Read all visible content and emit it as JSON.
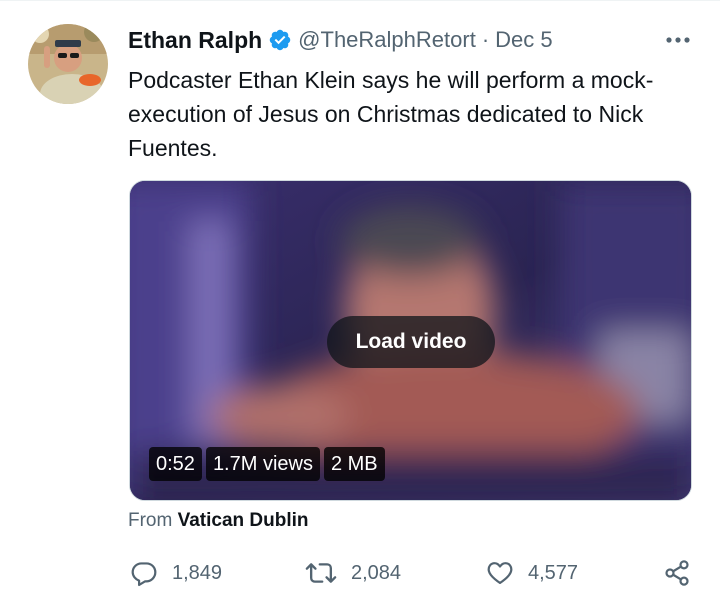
{
  "tweet": {
    "author": {
      "display_name": "Ethan Ralph",
      "verified": true,
      "handle": "@TheRalphRetort"
    },
    "separator": "·",
    "date": "Dec 5",
    "text": "Podcaster Ethan Klein says he will perform a mock-execution of Jesus on Christmas dedicated to Nick Fuentes.",
    "media": {
      "load_label": "Load video",
      "duration": "0:52",
      "views": "1.7M views",
      "size": "2 MB"
    },
    "source": {
      "prefix": "From",
      "name": "Vatican Dublin"
    },
    "stats": {
      "replies": "1,849",
      "retweets": "2,084",
      "likes": "4,577"
    }
  },
  "icons": {
    "verified": "verified-badge-icon",
    "more": "more-dots-icon",
    "reply": "reply-bubble-icon",
    "retweet": "retweet-icon",
    "like": "heart-icon",
    "share": "share-icon"
  },
  "colors": {
    "text_primary": "#0f1419",
    "text_secondary": "#536471",
    "verified_blue": "#1d9bf0",
    "divider": "#eff3f4"
  }
}
